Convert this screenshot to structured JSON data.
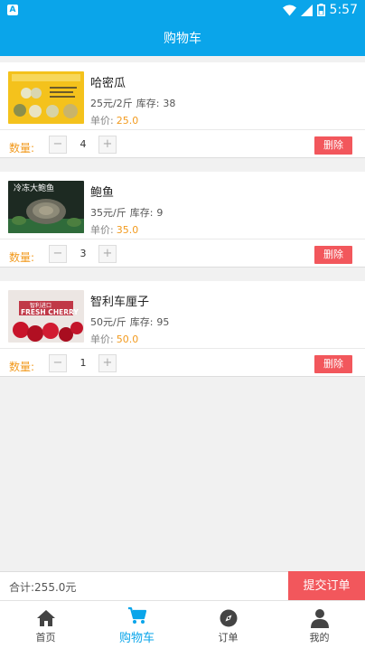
{
  "status_bar": {
    "time": "5:57",
    "app_badge": "A"
  },
  "header": {
    "title": "购物车"
  },
  "common": {
    "qty_label": "数量:",
    "delete_label": "删除",
    "stock_label": "库存:",
    "unit_price_label": "单价:",
    "minus": "−",
    "plus": "+"
  },
  "cart": {
    "items": [
      {
        "name": "哈密瓜",
        "spec": "25元/2斤",
        "stock": "38",
        "unit_price": "25.0",
        "qty": "4"
      },
      {
        "name": "鲍鱼",
        "spec": "35元/斤",
        "stock": "9",
        "unit_price": "35.0",
        "qty": "3"
      },
      {
        "name": "智利车厘子",
        "spec": "50元/斤",
        "stock": "95",
        "unit_price": "50.0",
        "qty": "1"
      }
    ]
  },
  "thumb_text": {
    "item2": "冷冻大鲍鱼",
    "item3_top": "智利进口",
    "item3_main": "FRESH CHERRY"
  },
  "summary": {
    "total_label": "合计:",
    "total": "255.0元",
    "submit_label": "提交订单"
  },
  "tabs": [
    {
      "label": "首页",
      "icon": "home-icon"
    },
    {
      "label": "购物车",
      "icon": "cart-icon"
    },
    {
      "label": "订单",
      "icon": "compass-icon"
    },
    {
      "label": "我的",
      "icon": "person-icon"
    }
  ],
  "colors": {
    "primary": "#0aa5ea",
    "accent_orange": "#f29a1e",
    "danger": "#f2575c"
  }
}
